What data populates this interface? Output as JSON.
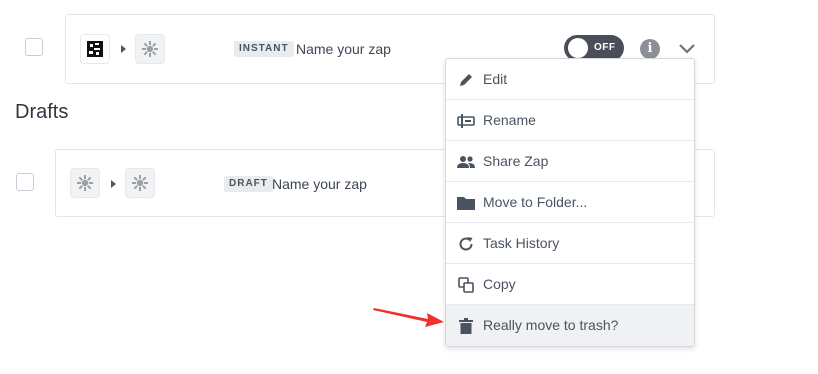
{
  "zaps": [
    {
      "status_badge": "INSTANT",
      "name": "Name your zap",
      "toggle_label": "OFF"
    }
  ],
  "drafts": {
    "title": "Drafts",
    "items": [
      {
        "status_badge": "DRAFT",
        "name": "Name your zap"
      }
    ]
  },
  "context_menu": {
    "items": [
      {
        "label": "Edit",
        "icon": "pencil-icon"
      },
      {
        "label": "Rename",
        "icon": "rename-icon"
      },
      {
        "label": "Share Zap",
        "icon": "people-icon"
      },
      {
        "label": "Move to Folder...",
        "icon": "folder-icon"
      },
      {
        "label": "Task History",
        "icon": "history-icon"
      },
      {
        "label": "Copy",
        "icon": "copy-icon"
      },
      {
        "label": "Really move to trash?",
        "icon": "trash-icon"
      }
    ]
  },
  "colors": {
    "accent_arrow": "#f0312b",
    "toggle_bg": "#4a4f57",
    "menu_hover": "#eff1f3"
  }
}
